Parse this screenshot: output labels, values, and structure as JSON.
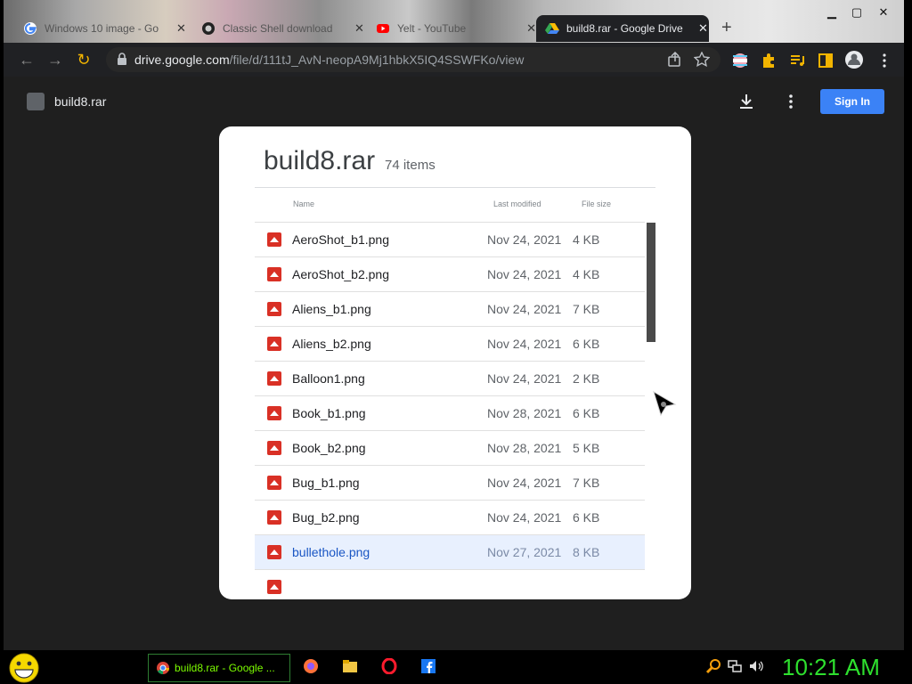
{
  "tabs": [
    {
      "title": "Windows 10 image - Go",
      "icon": "google-icon"
    },
    {
      "title": "Classic Shell download",
      "icon": "github-icon"
    },
    {
      "title": "Yelt - YouTube",
      "icon": "youtube-icon"
    },
    {
      "title": "build8.rar - Google Drive",
      "icon": "drive-icon",
      "active": true
    }
  ],
  "omnibox": {
    "url_host": "drive.google.com",
    "url_path": "/file/d/111tJ_AvN-neopA9Mj1hbkX5IQ4SSWFKo/view"
  },
  "viewer": {
    "file_title": "build8.rar",
    "signin_label": "Sign In"
  },
  "archive": {
    "title": "build8.rar",
    "count": "74 items",
    "columns": {
      "name": "Name",
      "modified": "Last modified",
      "size": "File size"
    },
    "files": [
      {
        "name": "AeroShot_b1.png",
        "modified": "Nov 24, 2021",
        "size": "4 KB"
      },
      {
        "name": "AeroShot_b2.png",
        "modified": "Nov 24, 2021",
        "size": "4 KB"
      },
      {
        "name": "Aliens_b1.png",
        "modified": "Nov 24, 2021",
        "size": "7 KB"
      },
      {
        "name": "Aliens_b2.png",
        "modified": "Nov 24, 2021",
        "size": "6 KB"
      },
      {
        "name": "Balloon1.png",
        "modified": "Nov 24, 2021",
        "size": "2 KB"
      },
      {
        "name": "Book_b1.png",
        "modified": "Nov 28, 2021",
        "size": "6 KB"
      },
      {
        "name": "Book_b2.png",
        "modified": "Nov 28, 2021",
        "size": "5 KB"
      },
      {
        "name": "Bug_b1.png",
        "modified": "Nov 24, 2021",
        "size": "7 KB"
      },
      {
        "name": "Bug_b2.png",
        "modified": "Nov 24, 2021",
        "size": "6 KB"
      },
      {
        "name": "bullethole.png",
        "modified": "Nov 27, 2021",
        "size": "8 KB",
        "selected": true
      }
    ]
  },
  "taskbar": {
    "active_task": "build8.rar - Google ...",
    "clock": "10:21 AM"
  },
  "colors": {
    "accent": "#3b82f6",
    "file_icon": "#d93025",
    "clock": "#2ee02e"
  }
}
